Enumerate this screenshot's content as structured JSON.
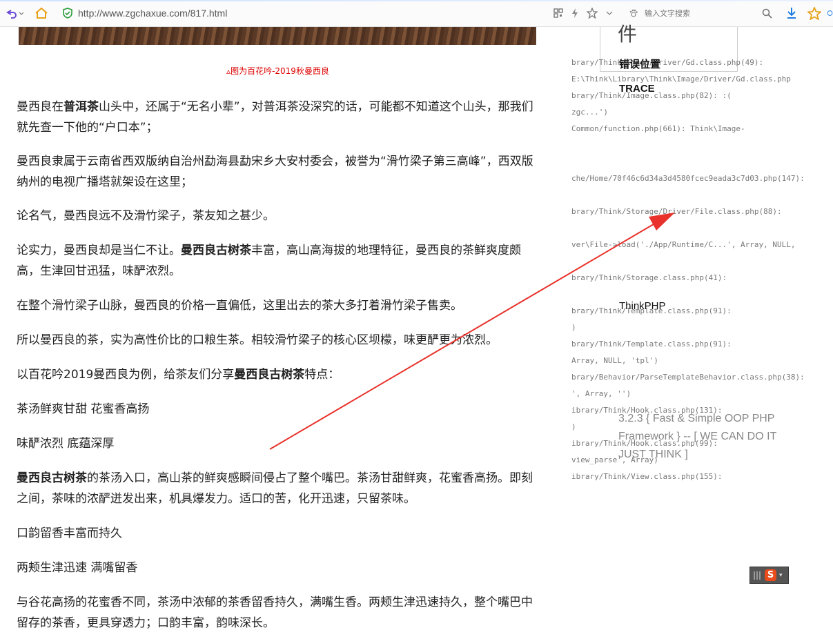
{
  "toolbar": {
    "url": "http://www.zgchaxue.com/817.html",
    "search_placeholder": "输入文字搜索"
  },
  "article": {
    "caption": "▵图为百花吟-2019秋曼西良",
    "p1": {
      "a": "曼西良在",
      "b": "普洱茶",
      "c": "山头中，还属于“无名小辈”，对普洱茶没深究的话，可能都不知道这个山头，那我们就先查一下他的“户口本”；"
    },
    "p2": "曼西良隶属于云南省西双版纳自治州勐海县勐宋乡大安村委会，被誉为“滑竹梁子第三高峰”，西双版纳州的电视广播塔就架设在这里；",
    "p3": "论名气，曼西良远不及滑竹梁子，茶友知之甚少。",
    "p4": {
      "a": "论实力，曼西良却是当仁不让。",
      "b": "曼西良古树茶",
      "c": "丰富，高山高海拔的地理特征，曼西良的茶鲜爽度颇高，生津回甘迅猛，味酽浓烈。"
    },
    "p5": "在整个滑竹梁子山脉，曼西良的价格一直偏低，这里出去的茶大多打着滑竹梁子售卖。",
    "p6": "所以曼西良的茶，实为高性价比的口粮生茶。相较滑竹梁子的核心区坝檬，味更酽更为浓烈。",
    "p7": {
      "a": "以百花吟2019曼西良为例，给茶友们分享",
      "b": "曼西良古树茶",
      "c": "特点："
    },
    "p8": "茶汤鲜爽甘甜 花蜜香高扬",
    "p9": "味酽浓烈 底蕴深厚",
    "p10": {
      "b": "曼西良古树茶",
      "c": "的茶汤入口，高山茶的鲜爽感瞬间侵占了整个嘴巴。茶汤甘甜鲜爽，花蜜香高扬。即刻之间，茶味的浓酽迸发出来，机具爆发力。适口的苦，化开迅速，只留茶味。"
    },
    "p11": "口韵留香丰富而持久",
    "p12": "两颊生津迅速 满嘴留香",
    "p13": "与谷花高扬的花蜜香不同，茶汤中浓郁的茶香留香持久，满嘴生香。两颊生津迅速持久，整个嘴巴中留存的茶香，更具穿透力；口韵丰富，韵味深长。"
  },
  "error_panel": {
    "box_title": "件",
    "heading_error_pos": "错误位置",
    "heading_trace": "TRACE",
    "brand": "ThinkPHP",
    "framework_line": "3.2.3 { Fast & Simple OOP PHP Framework } -- [ WE CAN DO IT JUST THINK ]",
    "trace_lines": [
      "brary/Think/Image/Driver/Gd.class.php(49):",
      "E:\\Think\\Library\\Think\\Image/Driver/Gd.class.php",
      "brary/Think/Image.class.php(82):                :(",
      "zgc...')",
      "Common/function.php(661): Think\\Image-",
      "che/Home/70f46c6d34a3d4580fcec9eada3c7d03.php(147):",
      "brary/Think/Storage/Driver/File.class.php(88):",
      "ver\\File->load('./App/Runtime/C...', Array, NULL,",
      "brary/Think/Storage.class.php(41):",
      "brary/Think/Template.class.php(91):",
      ")",
      "brary/Think/Template.class.php(91):",
      " Array, NULL, 'tpl')",
      "brary/Behavior/ParseTemplateBehavior.class.php(38):",
      "', Array, '')",
      "ibrary/Think/Hook.class.php(131):",
      ")",
      "ibrary/Think/Hook.class.php(99):",
      "view_parse', Array)",
      "ibrary/Think/View.class.php(155):"
    ]
  },
  "colors": {
    "arrow": "#e8322b",
    "caption": "#dd0000"
  }
}
